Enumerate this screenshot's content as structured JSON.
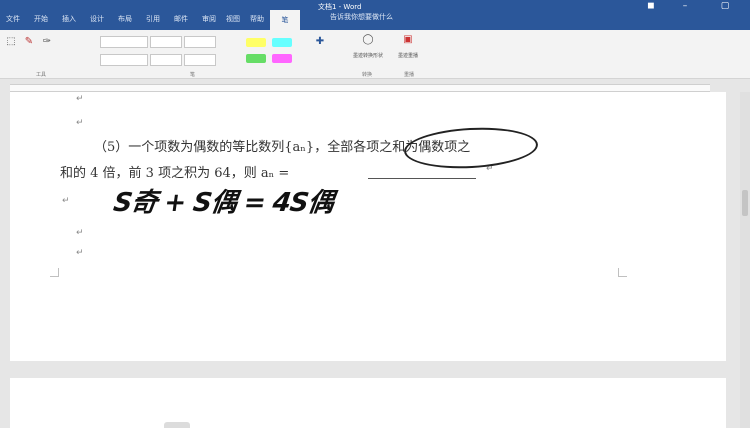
{
  "titlebar": {
    "doc_title": "文档1 - Word",
    "tell_me": "告诉我你想要做什么",
    "tabs": [
      "文件",
      "开始",
      "插入",
      "设计",
      "布局",
      "引用",
      "邮件",
      "审阅",
      "视图",
      "帮助"
    ],
    "active_tab": "笔"
  },
  "ribbon": {
    "group_labels": [
      "工具",
      "笔",
      "转换",
      "重播"
    ],
    "buttons": {
      "ink_to_shape": "墨迹转换形状",
      "ink_replay": "墨迹重播"
    }
  },
  "colors": {
    "brand": "#2b579a",
    "highlighters": [
      "#ffff66",
      "#66ffff",
      "#66dd66",
      "#ff66ff"
    ]
  },
  "document": {
    "line1": "（5）一个项数为偶数的等比数列{aₙ}，全部各项之和为偶数项之",
    "line2": "和的 4 倍，前 3 项之积为 64，则 aₙ =",
    "handwriting": "S奇 + S偶 = 4S偶"
  }
}
